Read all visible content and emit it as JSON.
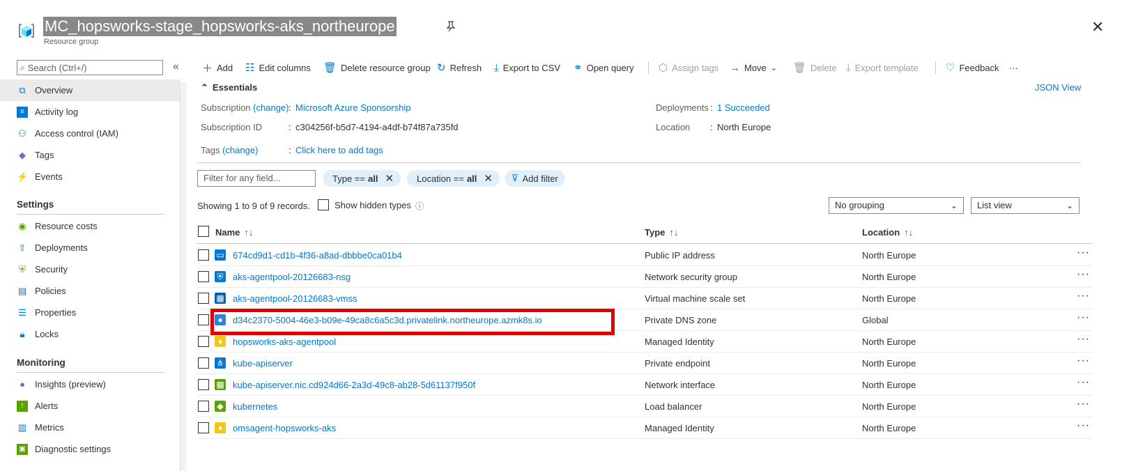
{
  "header": {
    "title": "MC_hopsworks-stage_hopsworks-aks_northeurope",
    "subtitle": "Resource group",
    "pin_icon": "pin-icon",
    "close_icon": "close-icon"
  },
  "sidebar": {
    "search_placeholder": "Search (Ctrl+/)",
    "collapse_glyph": "«",
    "items": [
      {
        "label": "Overview",
        "icon": "overview-icon"
      },
      {
        "label": "Activity log",
        "icon": "activity-log-icon"
      },
      {
        "label": "Access control (IAM)",
        "icon": "iam-icon"
      },
      {
        "label": "Tags",
        "icon": "tag-icon"
      },
      {
        "label": "Events",
        "icon": "lightning-icon"
      }
    ],
    "settings_header": "Settings",
    "settings_items": [
      {
        "label": "Resource costs",
        "icon": "cost-icon"
      },
      {
        "label": "Deployments",
        "icon": "deployments-icon"
      },
      {
        "label": "Security",
        "icon": "security-icon"
      },
      {
        "label": "Policies",
        "icon": "policies-icon"
      },
      {
        "label": "Properties",
        "icon": "properties-icon"
      },
      {
        "label": "Locks",
        "icon": "lock-icon"
      }
    ],
    "monitoring_header": "Monitoring",
    "monitoring_items": [
      {
        "label": "Insights (preview)",
        "icon": "insights-icon"
      },
      {
        "label": "Alerts",
        "icon": "alerts-icon"
      },
      {
        "label": "Metrics",
        "icon": "metrics-icon"
      },
      {
        "label": "Diagnostic settings",
        "icon": "diagnostic-icon"
      }
    ]
  },
  "toolbar": {
    "add": "Add",
    "edit_columns": "Edit columns",
    "delete_rg": "Delete resource group",
    "refresh": "Refresh",
    "export_csv": "Export to CSV",
    "open_query": "Open query",
    "assign_tags": "Assign tags",
    "move": "Move",
    "delete": "Delete",
    "export_template": "Export template",
    "feedback": "Feedback",
    "more": "···"
  },
  "essentials": {
    "header": "Essentials",
    "json_view": "JSON View",
    "subscription_label": "Subscription",
    "change": "(change)",
    "subscription_value": "Microsoft Azure Sponsorship",
    "subscription_id_label": "Subscription ID",
    "subscription_id_value": "c304256f-b5d7-4194-a4df-b74f87a735fd",
    "tags_label": "Tags",
    "tags_value": "Click here to add tags",
    "deployments_label": "Deployments",
    "deployments_value": "1 Succeeded",
    "location_label": "Location",
    "location_value": "North Europe",
    "colon": ":"
  },
  "filters": {
    "placeholder": "Filter for any field...",
    "type_pill_prefix": "Type ==",
    "type_pill_value": "all",
    "location_pill_prefix": "Location ==",
    "location_pill_value": "all",
    "add_filter": "Add filter"
  },
  "records": {
    "text": "Showing 1 to 9 of 9 records.",
    "show_hidden": "Show hidden types",
    "grouping": "No grouping",
    "view": "List view"
  },
  "table": {
    "columns": [
      "Name",
      "Type",
      "Location"
    ],
    "sort_glyph": "↑↓",
    "rows": [
      {
        "name": "674cd9d1-cd1b-4f36-a8ad-dbbbe0ca01b4",
        "type": "Public IP address",
        "location": "North Europe",
        "icon": "public-ip-icon",
        "color": "#0078d4"
      },
      {
        "name": "aks-agentpool-20126683-nsg",
        "type": "Network security group",
        "location": "North Europe",
        "icon": "nsg-shield-icon",
        "color": "#0078d4"
      },
      {
        "name": "aks-agentpool-20126683-vmss",
        "type": "Virtual machine scale set",
        "location": "North Europe",
        "icon": "vmss-icon",
        "color": "#0063b1"
      },
      {
        "name": "d34c2370-5004-46e3-b09e-49ca8c6a5c3d.privatelink.northeurope.azmk8s.io",
        "type": "Private DNS zone",
        "location": "Global",
        "icon": "dns-zone-icon",
        "color": "#2b88d8"
      },
      {
        "name": "hopsworks-aks-agentpool",
        "type": "Managed Identity",
        "location": "North Europe",
        "icon": "managed-identity-icon",
        "color": "#f2c811"
      },
      {
        "name": "kube-apiserver",
        "type": "Private endpoint",
        "location": "North Europe",
        "icon": "private-endpoint-icon",
        "color": "#0078d4"
      },
      {
        "name": "kube-apiserver.nic.cd924d66-2a3d-49c8-ab28-5d61137f950f",
        "type": "Network interface",
        "location": "North Europe",
        "icon": "nic-icon",
        "color": "#57a300"
      },
      {
        "name": "kubernetes",
        "type": "Load balancer",
        "location": "North Europe",
        "icon": "load-balancer-icon",
        "color": "#57a300"
      },
      {
        "name": "omsagent-hopsworks-aks",
        "type": "Managed Identity",
        "location": "North Europe",
        "icon": "managed-identity-icon",
        "color": "#f2c811"
      }
    ],
    "more_glyph": "···"
  },
  "colors": {
    "accent": "#0078d4",
    "highlight": "#e00000",
    "pill_bg": "#e1effa"
  }
}
